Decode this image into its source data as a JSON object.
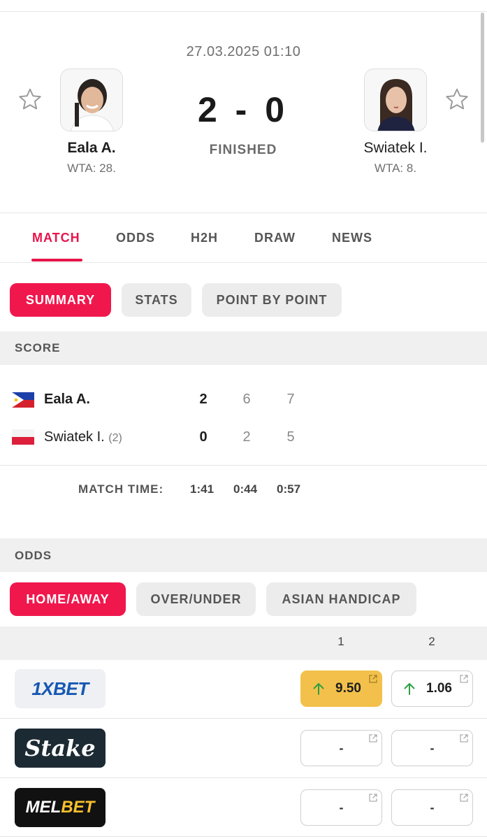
{
  "match": {
    "datetime": "27.03.2025 01:10",
    "score": "2 - 0",
    "status": "FINISHED",
    "home": {
      "name": "Eala A.",
      "rank": "WTA: 28."
    },
    "away": {
      "name": "Swiatek I.",
      "rank": "WTA: 8."
    }
  },
  "tabs": [
    "MATCH",
    "ODDS",
    "H2H",
    "DRAW",
    "NEWS"
  ],
  "subtabs": [
    "SUMMARY",
    "STATS",
    "POINT BY POINT"
  ],
  "score_section": {
    "label": "SCORE",
    "rows": [
      {
        "name": "Eala A.",
        "seed": "",
        "sets": "2",
        "set1": "6",
        "set2": "7"
      },
      {
        "name": "Swiatek I.",
        "seed": "(2)",
        "sets": "0",
        "set1": "2",
        "set2": "5"
      }
    ],
    "match_time_label": "MATCH TIME:",
    "match_time": [
      "1:41",
      "0:44",
      "0:57"
    ]
  },
  "odds_section": {
    "label": "ODDS",
    "tabs": [
      "HOME/AWAY",
      "OVER/UNDER",
      "ASIAN HANDICAP"
    ],
    "col1": "1",
    "col2": "2",
    "bookmakers": [
      {
        "name": "1XBET",
        "odd1": "9.50",
        "odd2": "1.06"
      },
      {
        "name": "Stake",
        "odd1": "-",
        "odd2": "-"
      },
      {
        "name_part1": "MEL",
        "name_part2": "BET",
        "odd1": "-",
        "odd2": "-"
      }
    ]
  },
  "colors": {
    "accent": "#e7144b",
    "highlight": "#f3c14b",
    "up_arrow": "#2ea043"
  }
}
